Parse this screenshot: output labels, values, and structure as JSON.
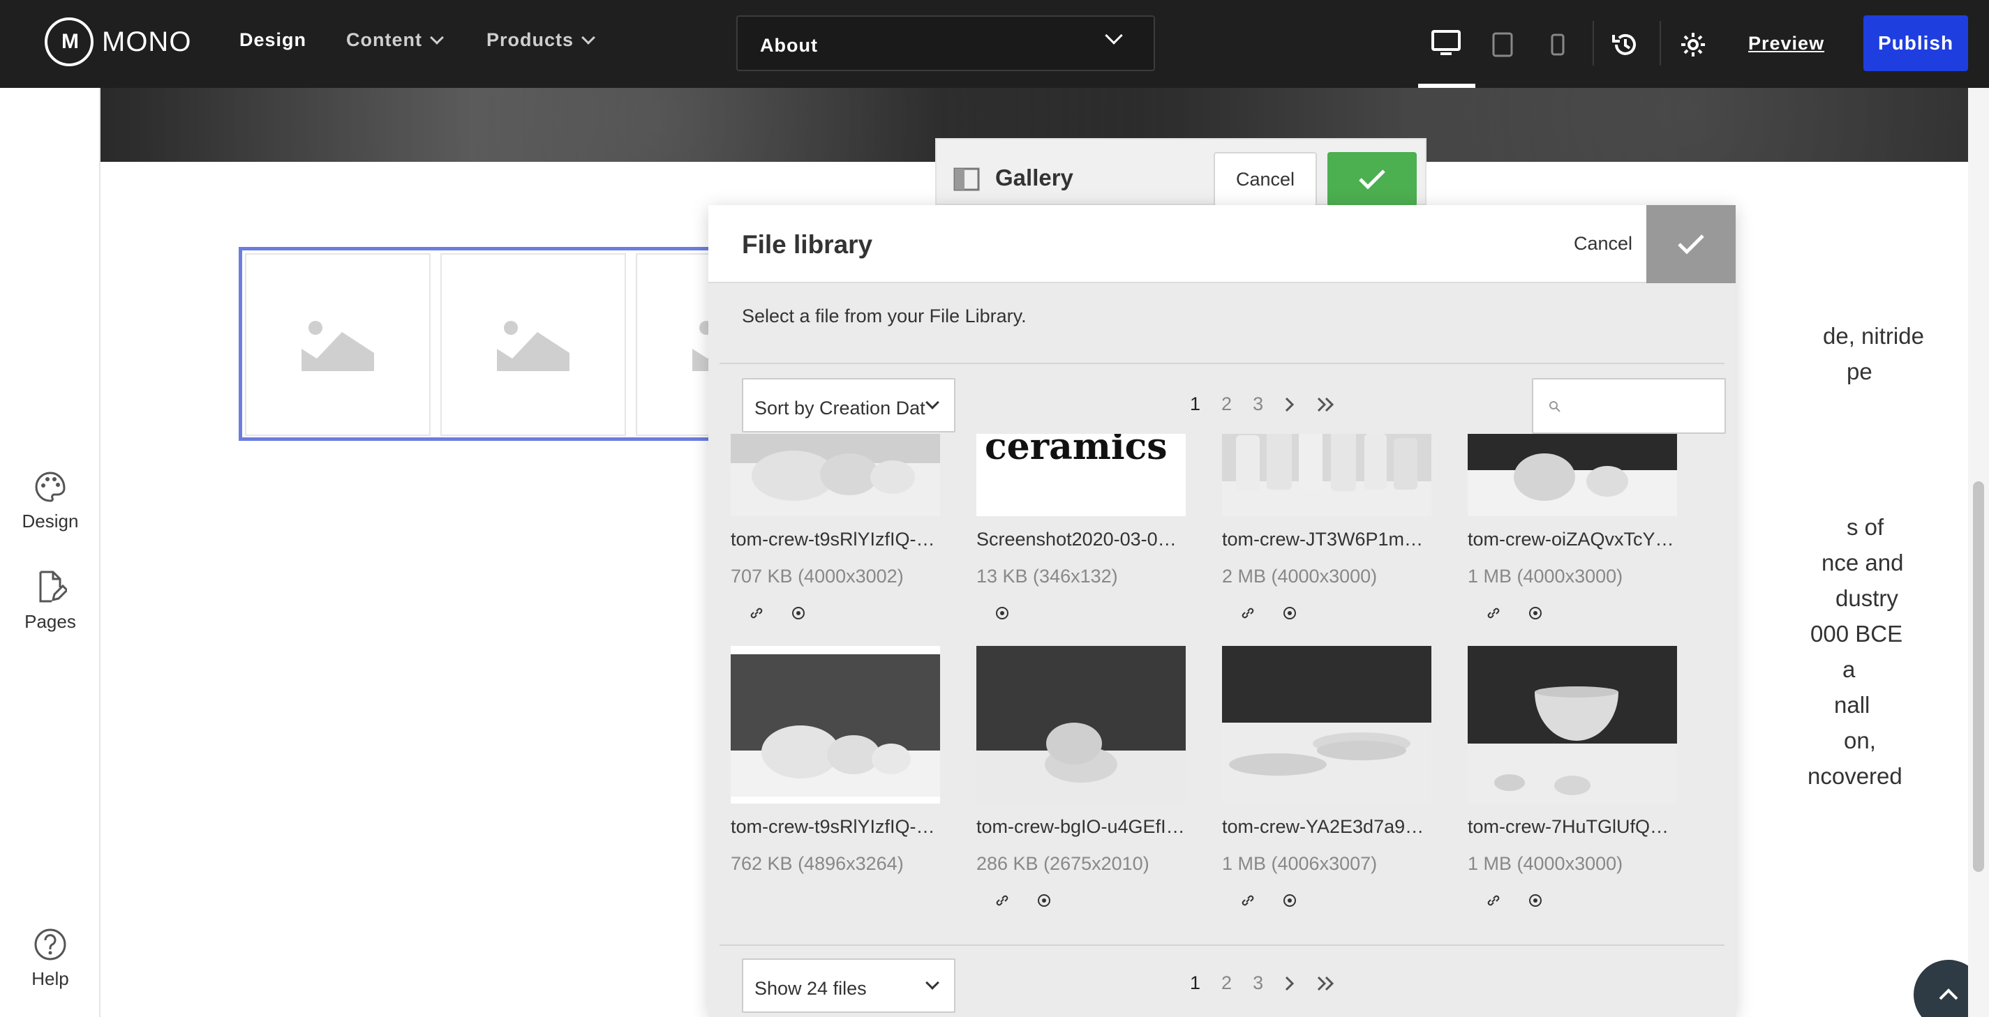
{
  "topbar": {
    "logo_mark": "M",
    "logo_text": "MONO",
    "nav": [
      {
        "label": "Design"
      },
      {
        "label": "Content"
      },
      {
        "label": "Products"
      }
    ],
    "page_select_value": "About",
    "preview_label": "Preview",
    "publish_label": "Publish"
  },
  "left_rail": {
    "items": [
      {
        "label": "Design"
      },
      {
        "label": "Pages"
      },
      {
        "label": "Help"
      }
    ]
  },
  "canvas": {
    "body_lines": [
      "de, nitride",
      "pe",
      "s of",
      "nce and",
      "dustry",
      "000 BCE",
      "a",
      "nall",
      "on,",
      "ncovered"
    ]
  },
  "gallery_bar": {
    "title": "Gallery",
    "cancel_label": "Cancel"
  },
  "file_library": {
    "title": "File library",
    "cancel_label": "Cancel",
    "subtitle": "Select a file from your File Library.",
    "sort_value": "Sort by Creation Dat",
    "show_value": "Show 24 files",
    "pages": [
      "1",
      "2",
      "3"
    ],
    "current_page": "1",
    "files": [
      {
        "name": "tom-crew-t9sRlYIzfIQ-un…",
        "meta": "707 KB (4000x3002)",
        "thumb": "bowls-three"
      },
      {
        "name": "Screenshot2020-03-09a…",
        "meta": "13 KB (346x132)",
        "thumb": "ceramics-logo",
        "thumb_text": "ceramics"
      },
      {
        "name": "tom-crew-JT3W6P1mYt…",
        "meta": "2 MB (4000x3000)",
        "thumb": "cups-many"
      },
      {
        "name": "tom-crew-oiZAQvxTcYQ-…",
        "meta": "1 MB (4000x3000)",
        "thumb": "jar-lid"
      },
      {
        "name": "tom-crew-t9sRlYIzfIQ-un…",
        "meta": "762 KB (4896x3264)",
        "thumb": "bowls-three"
      },
      {
        "name": "tom-crew-bgIO-u4GEfI-u…",
        "meta": "286 KB (2675x2010)",
        "thumb": "bowl-stack"
      },
      {
        "name": "tom-crew-YA2E3d7a9W…",
        "meta": "1 MB (4006x3007)",
        "thumb": "plates"
      },
      {
        "name": "tom-crew-7HuTGlUfQSo…",
        "meta": "1 MB (4000x3000)",
        "thumb": "bowl-large"
      }
    ]
  },
  "colors": {
    "topbar": "#1f1f1f",
    "publish": "#1f3ee0",
    "confirm_green": "#4caf50",
    "selection_outline": "#6b7de0"
  }
}
